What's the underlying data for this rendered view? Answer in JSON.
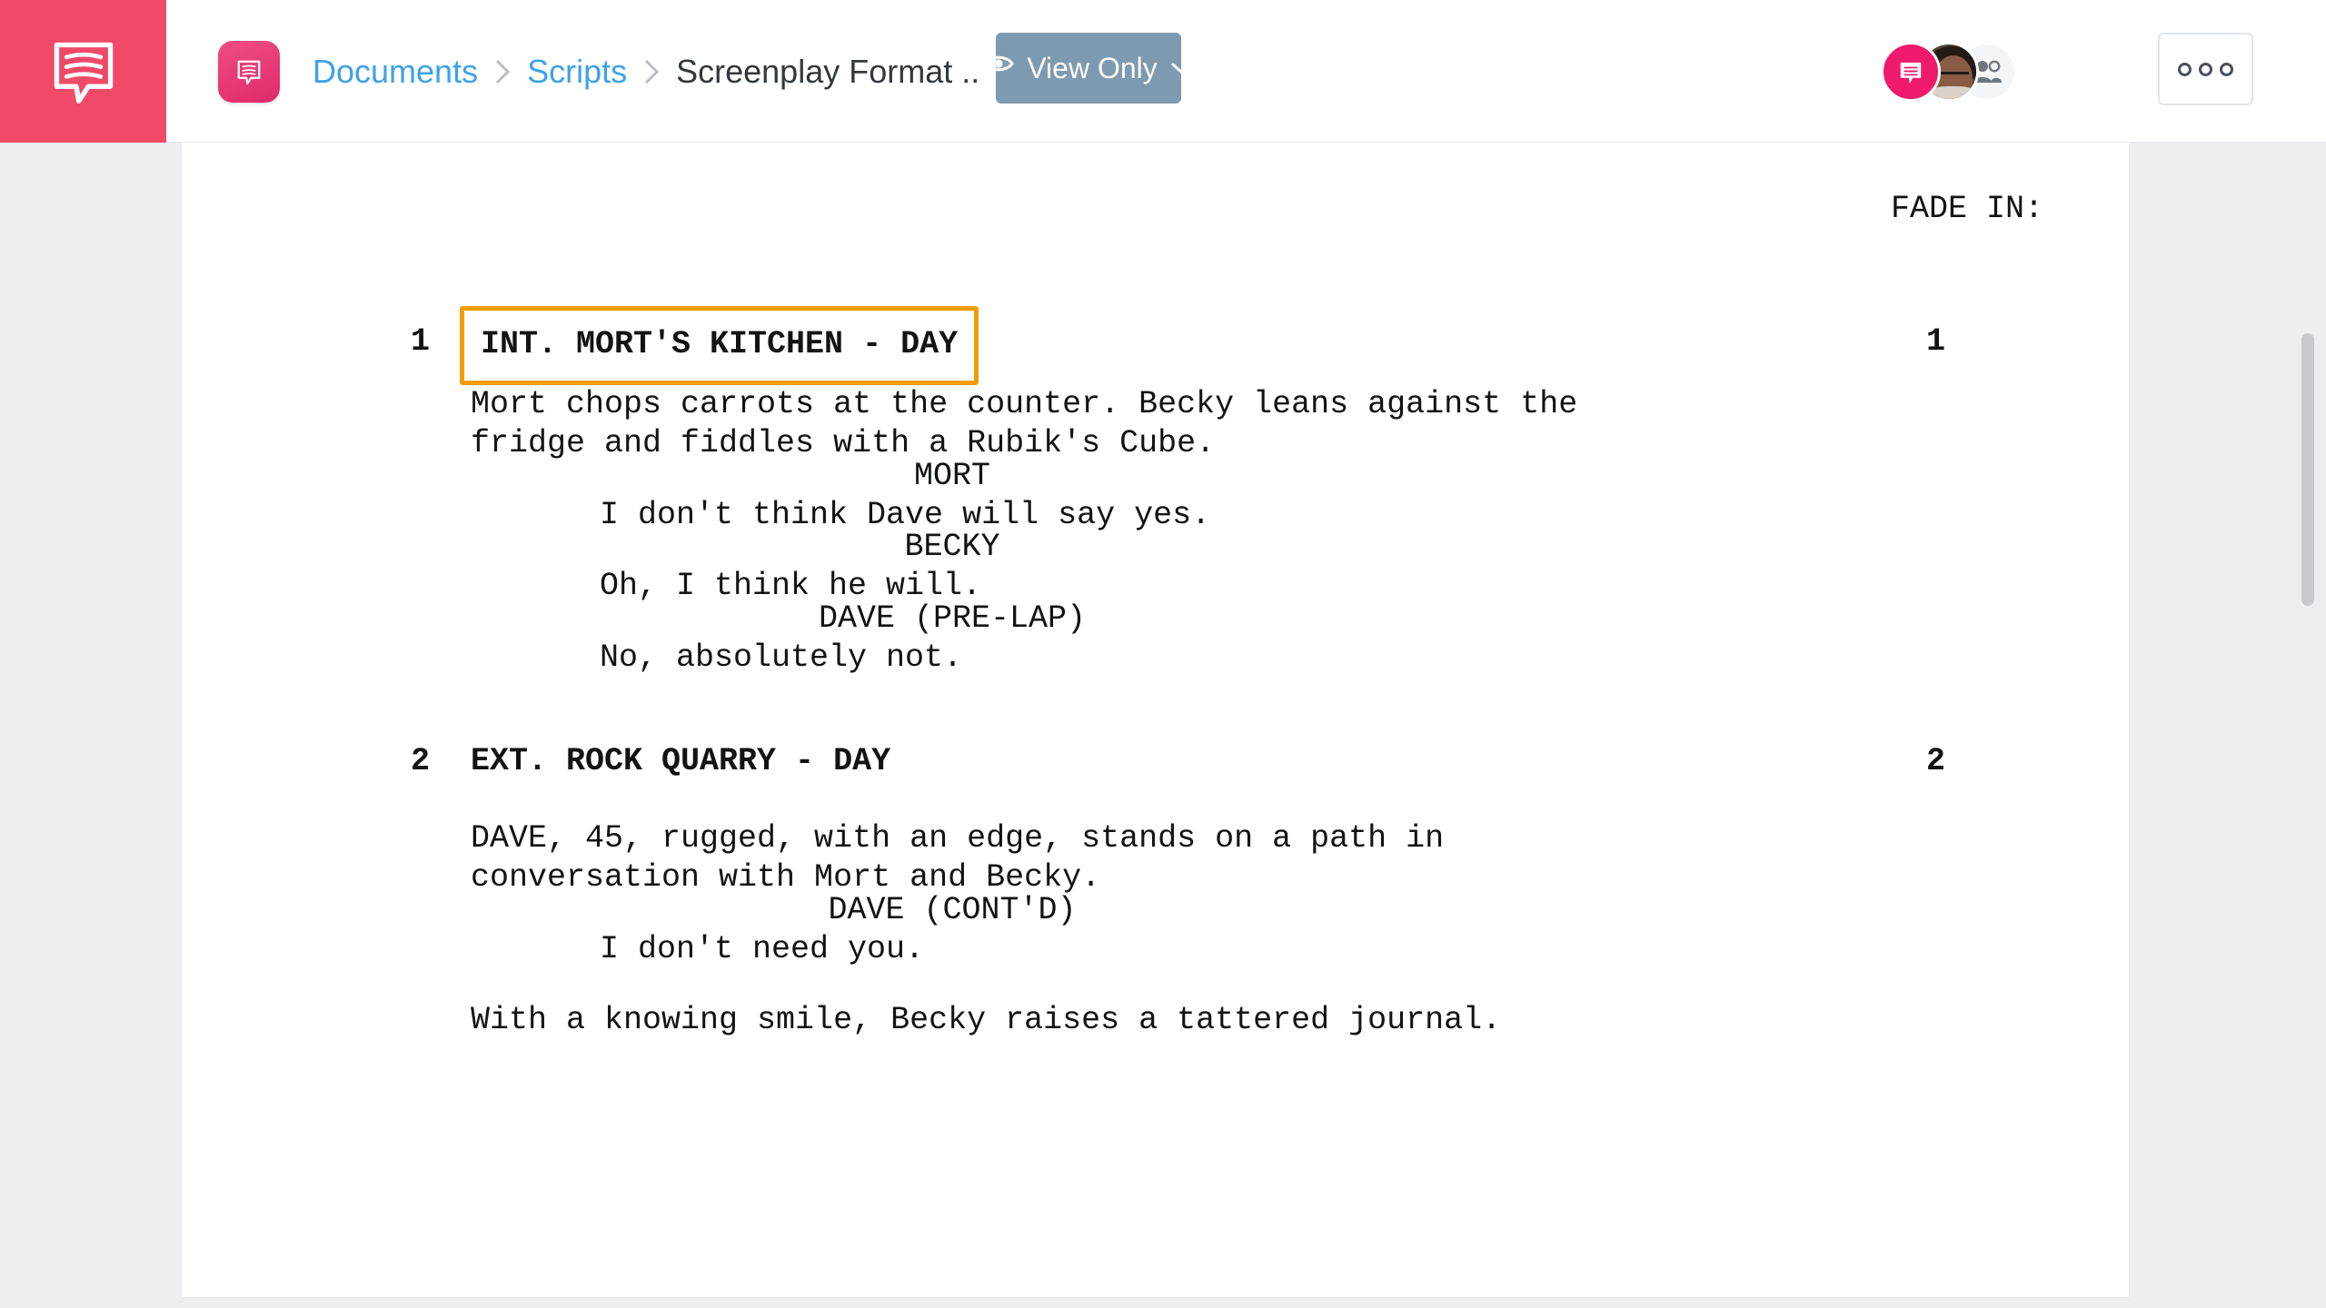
{
  "header": {
    "logo_icon": "speech-bubble-script-logo",
    "app_icon": "speech-bubble-app-icon",
    "breadcrumb": {
      "items": [
        {
          "label": "Documents",
          "type": "link"
        },
        {
          "label": "Scripts",
          "type": "link"
        },
        {
          "label": "Screenplay Format ..",
          "type": "current"
        }
      ],
      "separator": "chevron-right"
    },
    "view_mode_button": {
      "label": "View Only",
      "icon": "eye-icon",
      "caret": "chevron-down-icon",
      "color": "#7e9ab0"
    },
    "avatars": [
      {
        "name": "app-brand-avatar",
        "icon": "speech-bubble-icon",
        "color": "#ef1a6b"
      },
      {
        "name": "user-photo-avatar",
        "icon": "photo-avatar"
      },
      {
        "name": "collaborators-avatar",
        "icon": "people-icon",
        "color": "#f4f5f6"
      }
    ],
    "more_button": {
      "icon": "three-circles-icon",
      "label": "ooo"
    }
  },
  "document": {
    "transition": "FADE IN:",
    "highlighted_element": "INT. MORT'S KITCHEN - DAY",
    "highlight_color": "#f59c09",
    "scenes": [
      {
        "number": "1",
        "heading": "INT. MORT'S KITCHEN - DAY",
        "highlighted": true,
        "blocks": [
          {
            "type": "action",
            "lines": [
              "Mort chops carrots at the counter. Becky leans against the",
              "fridge and fiddles with a Rubik's Cube."
            ]
          },
          {
            "type": "dialogue",
            "character": "MORT",
            "lines": [
              "I don't think Dave will say yes."
            ]
          },
          {
            "type": "dialogue",
            "character": "BECKY",
            "lines": [
              "Oh, I think he will."
            ]
          },
          {
            "type": "dialogue",
            "character": "DAVE (PRE-LAP)",
            "lines": [
              "No, absolutely not."
            ]
          }
        ]
      },
      {
        "number": "2",
        "heading": "EXT. ROCK QUARRY - DAY",
        "highlighted": false,
        "blocks": [
          {
            "type": "action",
            "lines": [
              "DAVE, 45, rugged, with an edge, stands on a path in",
              "conversation with Mort and Becky."
            ]
          },
          {
            "type": "dialogue",
            "character": "DAVE (CONT'D)",
            "lines": [
              "I don't need you."
            ]
          },
          {
            "type": "action",
            "lines": [
              "With a knowing smile, Becky raises a tattered journal."
            ]
          }
        ]
      }
    ]
  },
  "scrollbar": {
    "name": "vertical-scrollbar"
  }
}
